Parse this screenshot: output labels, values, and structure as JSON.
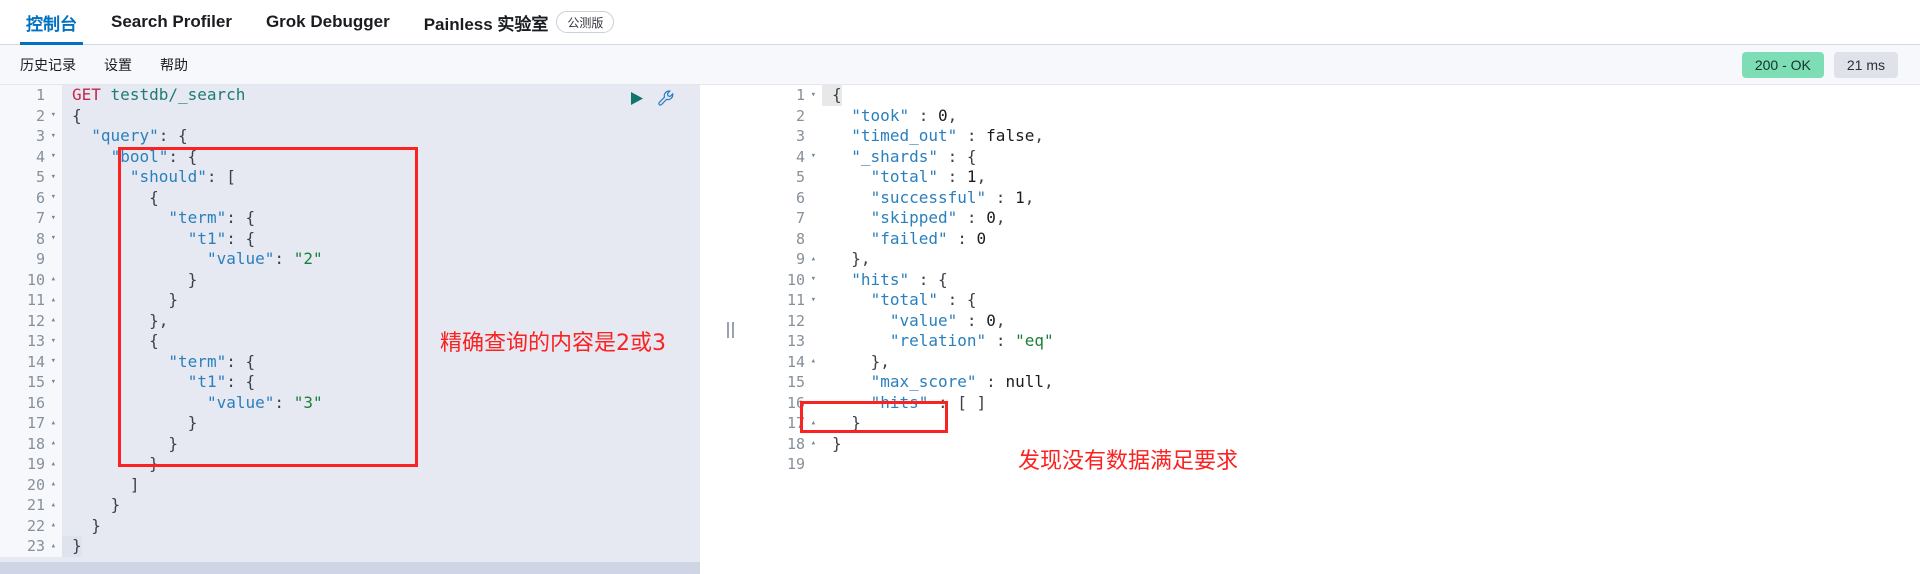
{
  "top_nav": {
    "tabs": [
      {
        "label": "控制台",
        "active": true
      },
      {
        "label": "Search Profiler",
        "active": false
      },
      {
        "label": "Grok Debugger",
        "active": false
      },
      {
        "label": "Painless 实验室",
        "active": false
      }
    ],
    "beta_badge": "公测版"
  },
  "sub_nav": {
    "tabs": [
      {
        "label": "历史记录"
      },
      {
        "label": "设置"
      },
      {
        "label": "帮助"
      }
    ],
    "status_code": "200 - OK",
    "elapsed": "21 ms"
  },
  "colors": {
    "accent": "#0071c2",
    "success_badge": "#7ddeb6",
    "neutral_badge": "#dfe2e9",
    "annotation_red": "#fb2222",
    "request_bg": "#e6e9f2",
    "key_blue": "#2a7fbd",
    "string_green": "#1a7f37",
    "method_crimson": "#c7254e",
    "url_teal": "#1d7b74"
  },
  "icons": {
    "play": "play-icon",
    "wrench": "wrench-icon",
    "splitter": "splitter-grip-icon"
  },
  "request": {
    "lines": [
      {
        "n": 1,
        "fold": "",
        "text": "GET testdb/_search"
      },
      {
        "n": 2,
        "fold": "▾",
        "text": "{"
      },
      {
        "n": 3,
        "fold": "▾",
        "text": "  \"query\": {"
      },
      {
        "n": 4,
        "fold": "▾",
        "text": "    \"bool\": {"
      },
      {
        "n": 5,
        "fold": "▾",
        "text": "      \"should\": ["
      },
      {
        "n": 6,
        "fold": "▾",
        "text": "        {"
      },
      {
        "n": 7,
        "fold": "▾",
        "text": "          \"term\": {"
      },
      {
        "n": 8,
        "fold": "▾",
        "text": "            \"t1\": {"
      },
      {
        "n": 9,
        "fold": "",
        "text": "              \"value\": \"2\""
      },
      {
        "n": 10,
        "fold": "▴",
        "text": "            }"
      },
      {
        "n": 11,
        "fold": "▴",
        "text": "          }"
      },
      {
        "n": 12,
        "fold": "▴",
        "text": "        },"
      },
      {
        "n": 13,
        "fold": "▾",
        "text": "        {"
      },
      {
        "n": 14,
        "fold": "▾",
        "text": "          \"term\": {"
      },
      {
        "n": 15,
        "fold": "▾",
        "text": "            \"t1\": {"
      },
      {
        "n": 16,
        "fold": "",
        "text": "              \"value\": \"3\""
      },
      {
        "n": 17,
        "fold": "▴",
        "text": "            }"
      },
      {
        "n": 18,
        "fold": "▴",
        "text": "          }"
      },
      {
        "n": 19,
        "fold": "▴",
        "text": "        }"
      },
      {
        "n": 20,
        "fold": "▴",
        "text": "      ]"
      },
      {
        "n": 21,
        "fold": "▴",
        "text": "    }"
      },
      {
        "n": 22,
        "fold": "▴",
        "text": "  }"
      },
      {
        "n": 23,
        "fold": "▴",
        "text": "}"
      }
    ]
  },
  "response": {
    "lines": [
      {
        "n": 1,
        "fold": "▾",
        "text": "{"
      },
      {
        "n": 2,
        "fold": "",
        "text": "  \"took\" : 0,"
      },
      {
        "n": 3,
        "fold": "",
        "text": "  \"timed_out\" : false,"
      },
      {
        "n": 4,
        "fold": "▾",
        "text": "  \"_shards\" : {"
      },
      {
        "n": 5,
        "fold": "",
        "text": "    \"total\" : 1,"
      },
      {
        "n": 6,
        "fold": "",
        "text": "    \"successful\" : 1,"
      },
      {
        "n": 7,
        "fold": "",
        "text": "    \"skipped\" : 0,"
      },
      {
        "n": 8,
        "fold": "",
        "text": "    \"failed\" : 0"
      },
      {
        "n": 9,
        "fold": "▴",
        "text": "  },"
      },
      {
        "n": 10,
        "fold": "▾",
        "text": "  \"hits\" : {"
      },
      {
        "n": 11,
        "fold": "▾",
        "text": "    \"total\" : {"
      },
      {
        "n": 12,
        "fold": "",
        "text": "      \"value\" : 0,"
      },
      {
        "n": 13,
        "fold": "",
        "text": "      \"relation\" : \"eq\""
      },
      {
        "n": 14,
        "fold": "▴",
        "text": "    },"
      },
      {
        "n": 15,
        "fold": "",
        "text": "    \"max_score\" : null,"
      },
      {
        "n": 16,
        "fold": "",
        "text": "    \"hits\" : [ ]"
      },
      {
        "n": 17,
        "fold": "▴",
        "text": "  }"
      },
      {
        "n": 18,
        "fold": "▴",
        "text": "}"
      },
      {
        "n": 19,
        "fold": "",
        "text": ""
      }
    ]
  },
  "annotations": {
    "request_note": "精确查询的内容是2或3",
    "response_note": "发现没有数据满足要求"
  }
}
